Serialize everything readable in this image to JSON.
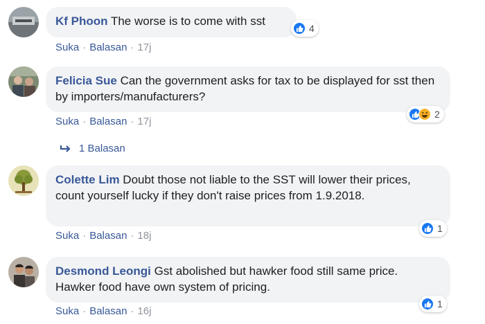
{
  "comments": [
    {
      "author": "Kf Phoon",
      "text": "The worse is to come with sst",
      "actions": {
        "like": "Suka",
        "reply": "Balasan",
        "time": "17j"
      },
      "reactions": {
        "icons": [
          "like-icon"
        ],
        "count": "4"
      }
    },
    {
      "author": "Felicia Sue",
      "text": "Can the government asks for tax to be displayed for sst then by importers/manufacturers?",
      "actions": {
        "like": "Suka",
        "reply": "Balasan",
        "time": "17j"
      },
      "reactions": {
        "icons": [
          "like-icon",
          "haha-icon"
        ],
        "count": "2"
      },
      "replies": "1 Balasan"
    },
    {
      "author": "Colette Lim",
      "text": "Doubt those not liable to the SST will lower their prices, count yourself lucky if they don't raise prices from 1.9.2018.",
      "actions": {
        "like": "Suka",
        "reply": "Balasan",
        "time": "18j"
      },
      "reactions": {
        "icons": [
          "like-icon"
        ],
        "count": "1"
      }
    },
    {
      "author": "Desmond Leongi",
      "text": "Gst abolished but hawker food still same price. Hawker food have own system of pricing.",
      "actions": {
        "like": "Suka",
        "reply": "Balasan",
        "time": "16j"
      },
      "reactions": {
        "icons": [
          "like-icon"
        ],
        "count": "1"
      }
    }
  ],
  "colors": {
    "author": "#385898",
    "bubble": "#f2f3f5",
    "like": "#1877f2",
    "haha": "#f7b125"
  },
  "separator": "·"
}
